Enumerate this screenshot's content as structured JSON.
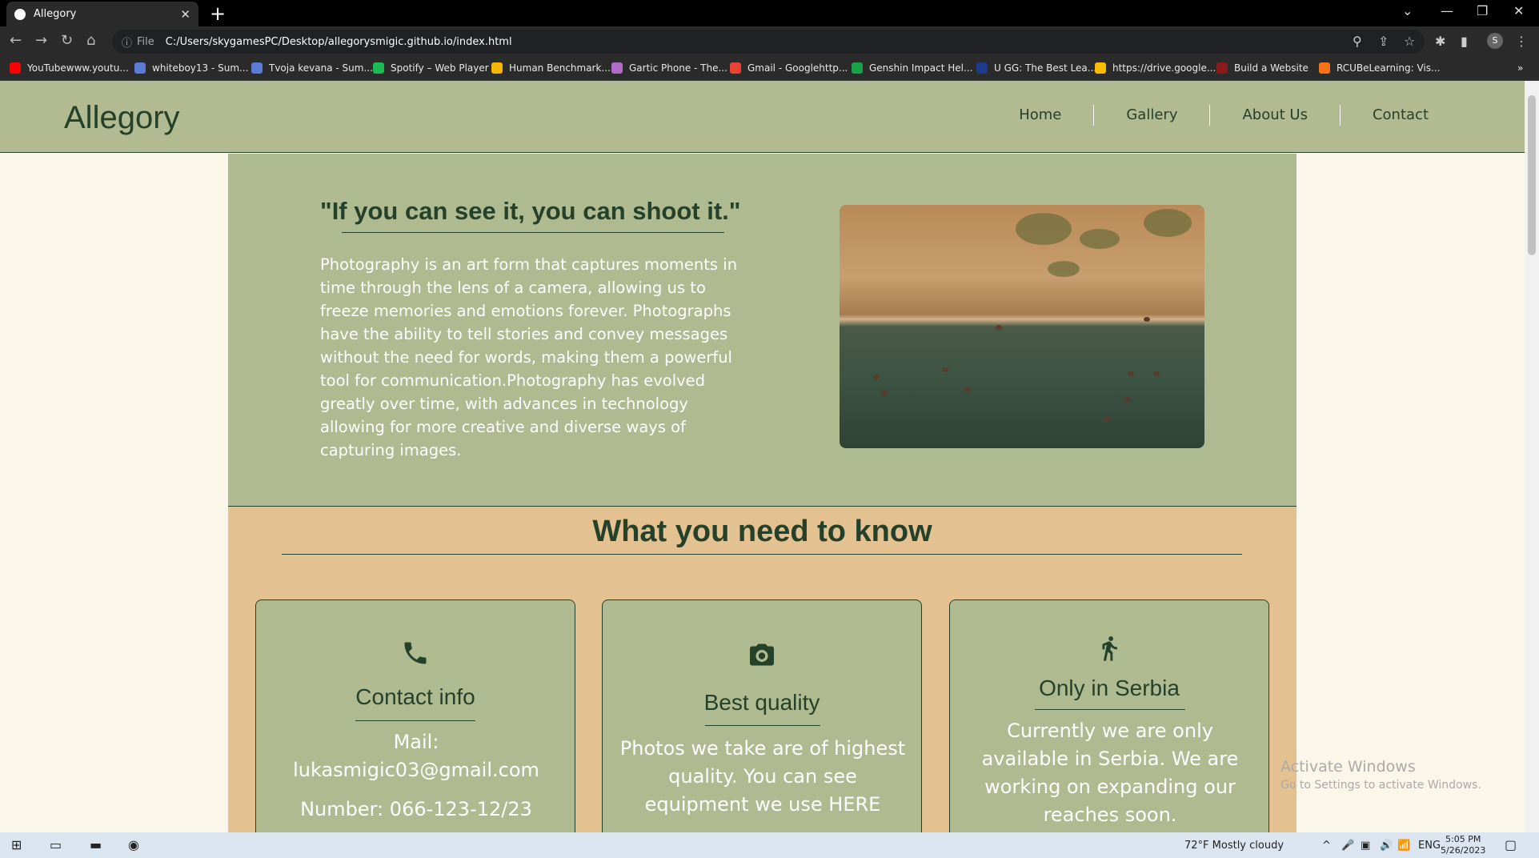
{
  "browser": {
    "tab_title": "Allegory",
    "file_label": "File",
    "url": "C:/Users/skygamesPC/Desktop/allegorysmigic.github.io/index.html",
    "profile_initial": "S",
    "bookmarks": [
      {
        "label": "YouTubewww.youtu...",
        "color": "#ff0000"
      },
      {
        "label": "whiteboy13 - Sum...",
        "color": "#5b7bd5"
      },
      {
        "label": "Tvoja kevana - Sum...",
        "color": "#5b7bd5"
      },
      {
        "label": "Spotify – Web Player",
        "color": "#1db954"
      },
      {
        "label": "Human Benchmark...",
        "color": "#f5b700"
      },
      {
        "label": "Gartic Phone - The...",
        "color": "#b06cc7"
      },
      {
        "label": "Gmail - Googlehttp...",
        "color": "#ea4335"
      },
      {
        "label": "Genshin Impact Hel...",
        "color": "#16a34a"
      },
      {
        "label": "U GG: The Best Lea...",
        "color": "#1e3a8a"
      },
      {
        "label": "https://drive.google...",
        "color": "#fbbc04"
      },
      {
        "label": "Build a Website",
        "color": "#8b1a1a"
      },
      {
        "label": "RCUBeLearning: Vis...",
        "color": "#f97316"
      }
    ]
  },
  "site": {
    "logo": "Allegory",
    "nav": [
      "Home",
      "Gallery",
      "About Us",
      "Contact"
    ],
    "hero": {
      "quote": "\"If you can see it, you can shoot it.\"",
      "text": "Photography is an art form that captures moments in time through the lens of a camera, allowing us to freeze memories and emotions forever. Photographs have the ability to tell stories and convey messages without the need for words, making them a powerful tool for communication.Photography has evolved greatly over time, with advances in technology allowing for more creative and diverse ways of capturing images."
    },
    "know": {
      "title": "What you need to know",
      "cards": [
        {
          "icon": "phone-icon",
          "title": "Contact info",
          "lines": [
            "Mail: lukasmigic03@gmail.com",
            "Number: 066-123-12/23"
          ]
        },
        {
          "icon": "camera-icon",
          "title": "Best quality",
          "lines": [
            "Photos we take are of highest quality. You can see equipment we use HERE"
          ]
        },
        {
          "icon": "running-person-icon",
          "title": "Only in Serbia",
          "lines": [
            "Currently we are only available in Serbia. We are working on expanding our reaches soon."
          ]
        }
      ]
    }
  },
  "watermark": {
    "title": "Activate Windows",
    "subtitle": "Go to Settings to activate Windows."
  },
  "taskbar": {
    "weather": "72°F  Mostly cloudy",
    "lang": "ENG",
    "time": "5:05 PM",
    "date": "5/26/2023"
  },
  "colors": {
    "sage": "#b0ba91",
    "dark_green": "#25412a",
    "sand": "#e4c190",
    "cream": "#fbf6ea"
  }
}
